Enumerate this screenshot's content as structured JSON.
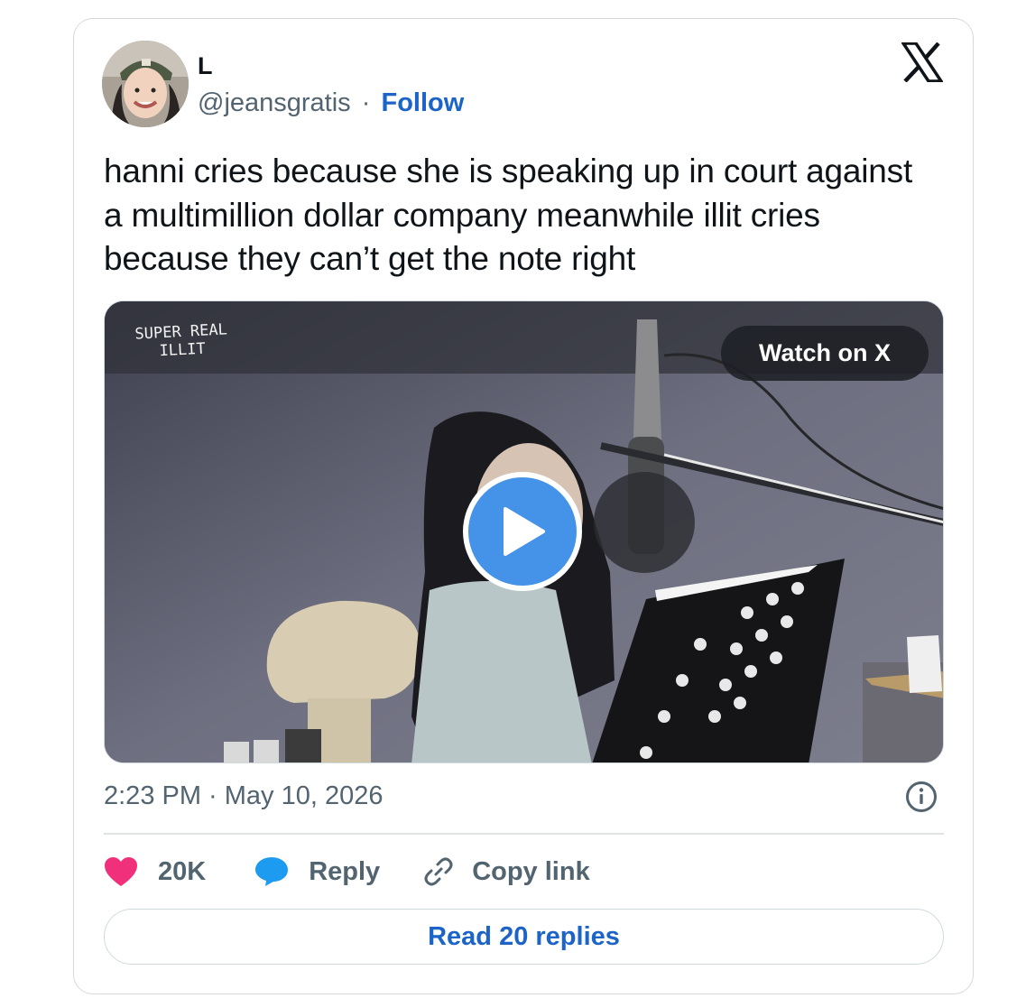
{
  "author": {
    "name": "L",
    "handle": "@jeansgratis",
    "separator": "·",
    "follow_label": "Follow"
  },
  "tweet": {
    "text": "hanni cries because she is speaking up in court against a multimillion dollar company meanwhile illit cries because they can’t get the note right"
  },
  "media": {
    "watermark_line1": "SUPER REAL",
    "watermark_line2": "ILLIT",
    "watch_label": "Watch on X",
    "play_icon": "play-icon"
  },
  "meta": {
    "timestamp": "2:23 PM · May 10, 2026"
  },
  "actions": {
    "likes": "20K",
    "reply_label": "Reply",
    "copy_label": "Copy link"
  },
  "read_replies_label": "Read 20 replies",
  "colors": {
    "accent": "#1d64c8",
    "like": "#f91880",
    "reply_icon": "#1d9bf0",
    "muted": "#536471",
    "play": "#4493e8"
  }
}
